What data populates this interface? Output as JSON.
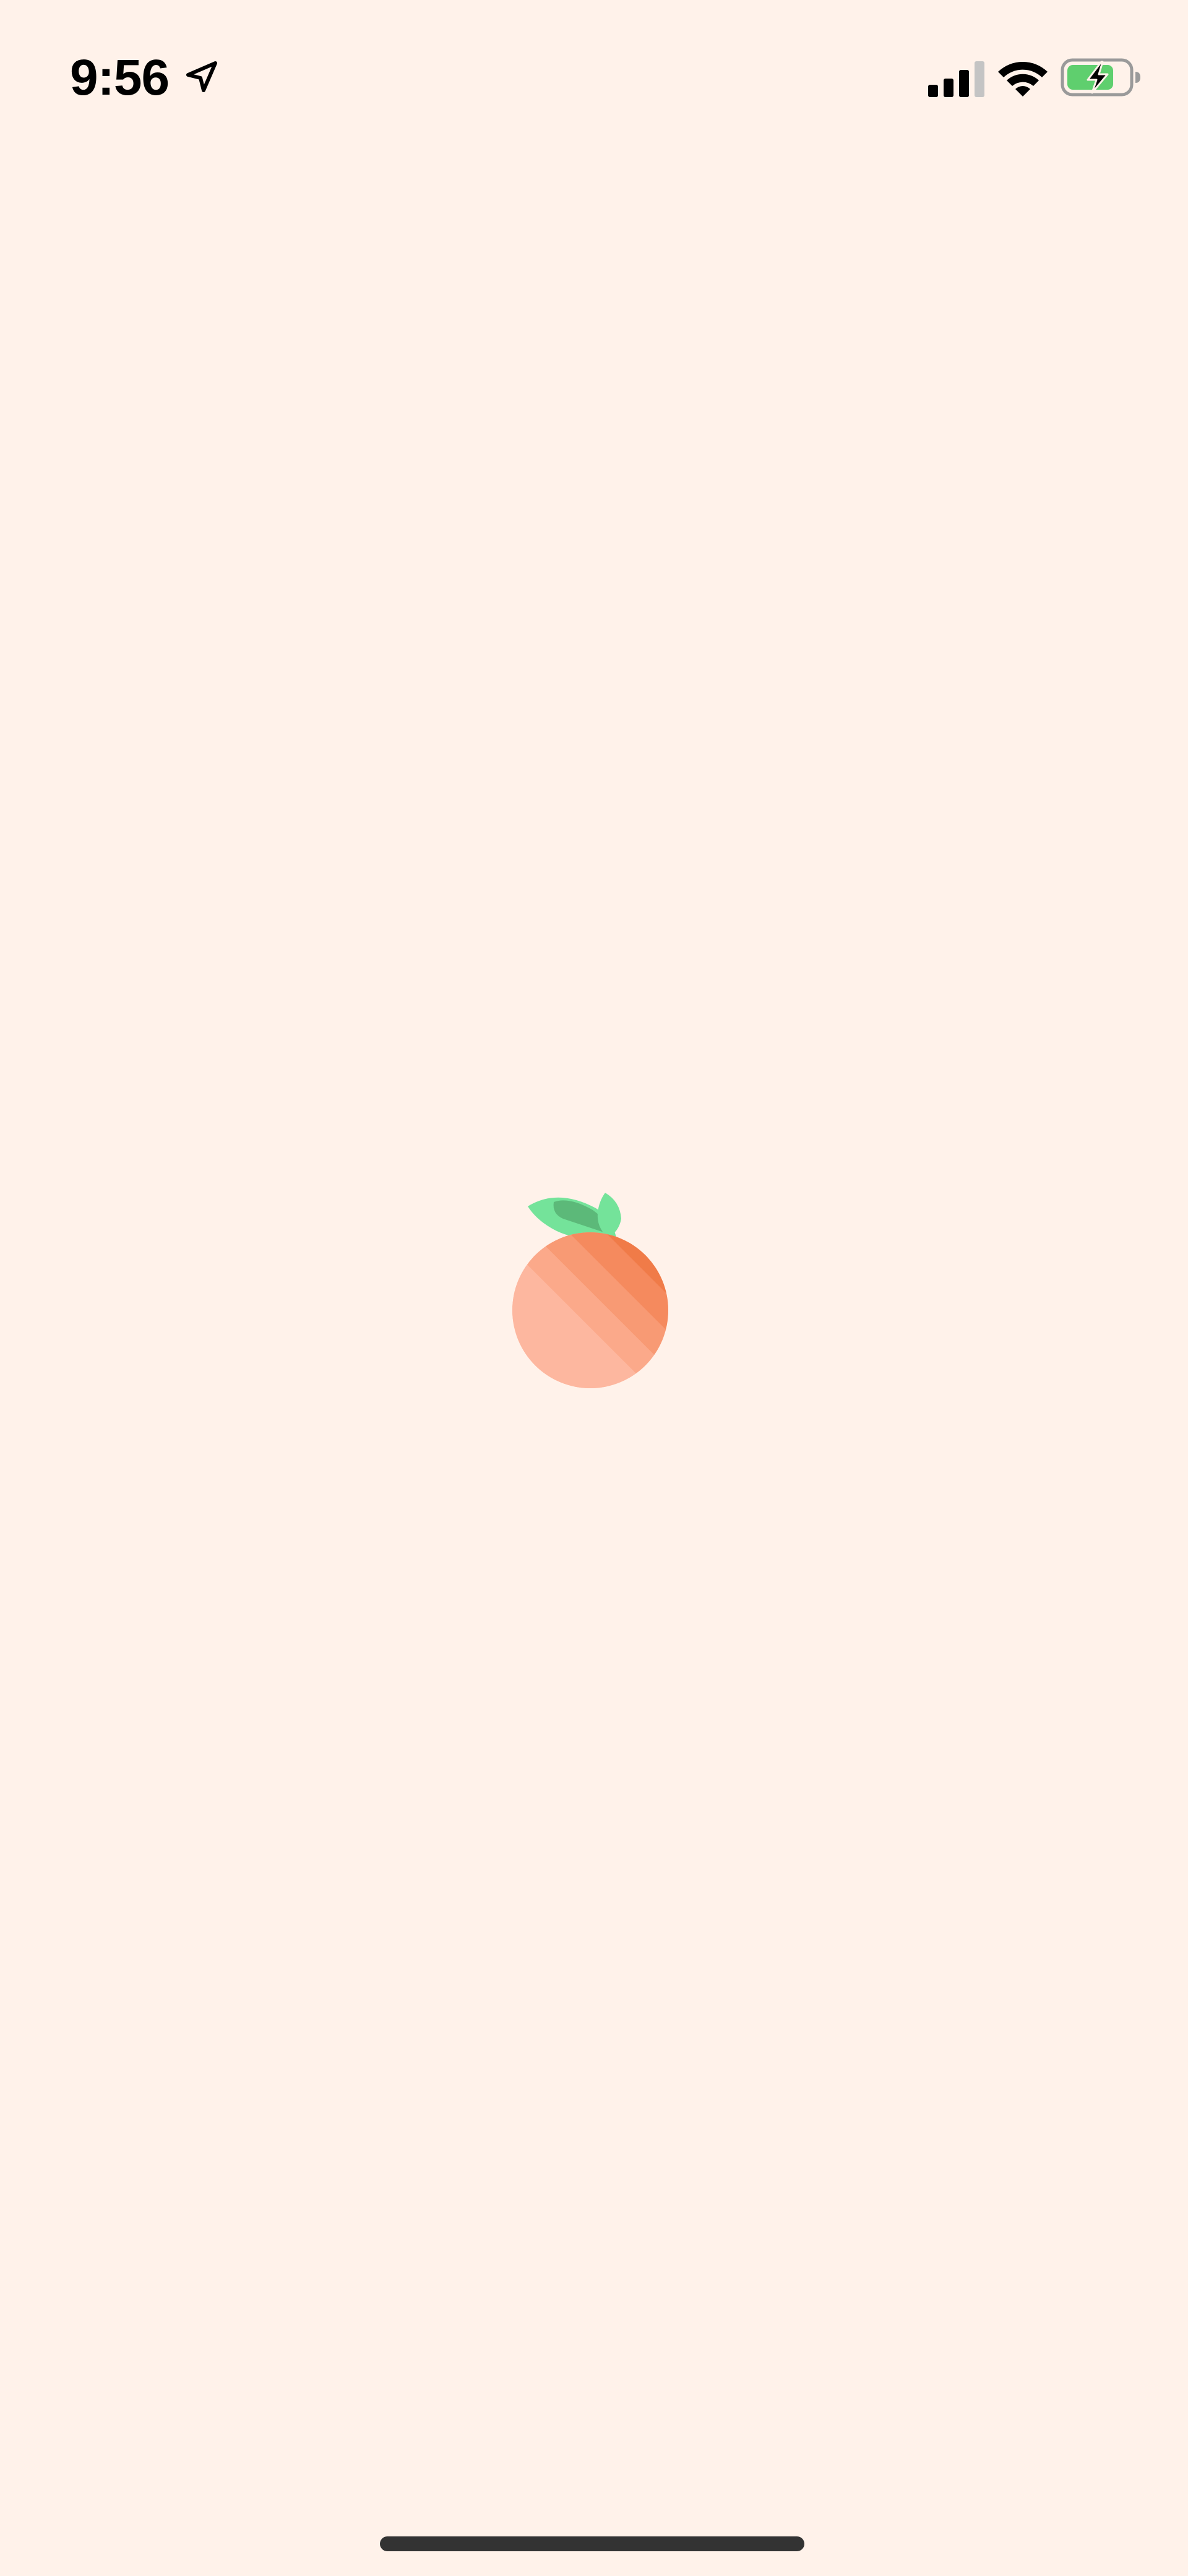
{
  "status_bar": {
    "time": "9:56",
    "icons": [
      "location-arrow-icon",
      "cellular-signal-icon",
      "wifi-icon",
      "battery-charging-icon"
    ],
    "signal_bars_active": 3,
    "signal_bars_total": 4,
    "battery_level": 0.7,
    "battery_charging": true
  },
  "splash": {
    "logo_icon": "orange-fruit-logo",
    "background_color": "#FFF2EA",
    "fruit_colors": [
      "#EE6A33",
      "#F07B48",
      "#F58A5E",
      "#F89A74",
      "#FBA98A",
      "#FDB79F"
    ],
    "leaf_colors": [
      "#74E39A",
      "#5CB979"
    ]
  },
  "colors": {
    "battery_fill": "#5FCF6E",
    "home_indicator": "#333333",
    "text": "#000000"
  }
}
